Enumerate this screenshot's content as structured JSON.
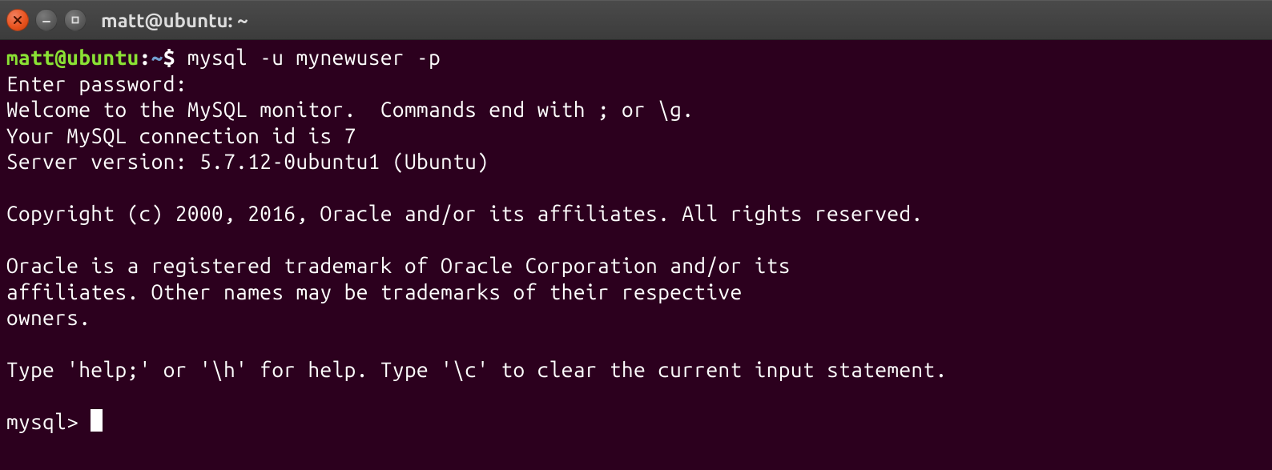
{
  "titlebar": {
    "title": "matt@ubuntu: ~"
  },
  "prompt": {
    "user_host": "matt@ubuntu",
    "colon": ":",
    "path": "~",
    "dollar": "$ "
  },
  "command": "mysql -u mynewuser -p",
  "output": {
    "line1": "Enter password: ",
    "line2": "Welcome to the MySQL monitor.  Commands end with ; or \\g.",
    "line3": "Your MySQL connection id is 7",
    "line4": "Server version: 5.7.12-0ubuntu1 (Ubuntu)",
    "blank1": "",
    "line5": "Copyright (c) 2000, 2016, Oracle and/or its affiliates. All rights reserved.",
    "blank2": "",
    "line6": "Oracle is a registered trademark of Oracle Corporation and/or its",
    "line7": "affiliates. Other names may be trademarks of their respective",
    "line8": "owners.",
    "blank3": "",
    "line9": "Type 'help;' or '\\h' for help. Type '\\c' to clear the current input statement.",
    "blank4": ""
  },
  "mysql_prompt": "mysql> "
}
